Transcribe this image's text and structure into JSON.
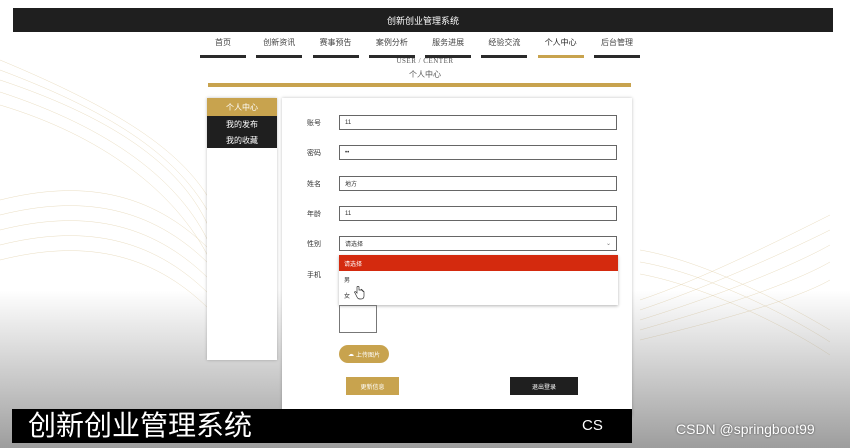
{
  "app": {
    "title": "创新创业管理系统"
  },
  "nav": {
    "items": [
      {
        "label": "首页"
      },
      {
        "label": "创新资讯"
      },
      {
        "label": "赛事预告"
      },
      {
        "label": "案例分析"
      },
      {
        "label": "服务进展"
      },
      {
        "label": "经验交流"
      },
      {
        "label": "个人中心"
      },
      {
        "label": "后台管理"
      }
    ],
    "active": "个人中心"
  },
  "section": {
    "title_en": "USER / CENTER",
    "title_cn": "个人中心"
  },
  "sidebar": {
    "items": [
      {
        "label": "个人中心"
      },
      {
        "label": "我的发布"
      },
      {
        "label": "我的收藏"
      }
    ]
  },
  "form": {
    "account": {
      "label": "账号",
      "value": "11"
    },
    "password": {
      "label": "密码",
      "value": "••"
    },
    "name": {
      "label": "姓名",
      "value": "地方"
    },
    "age": {
      "label": "年龄",
      "value": "11"
    },
    "gender": {
      "label": "性别",
      "value": "请选择",
      "options": [
        {
          "label": "请选择"
        },
        {
          "label": "男"
        },
        {
          "label": "女"
        }
      ]
    },
    "phone": {
      "label": "手机"
    },
    "upload_label": "上传图片",
    "update_label": "更新信息",
    "logout_label": "退出登录"
  },
  "caption": {
    "title": "创新创业管理系统",
    "logo_text": "CS"
  },
  "watermark": "CSDN @springboot99",
  "colors": {
    "accent": "#c8a34e",
    "dark": "#1f1f1f",
    "selected_option": "#d42a0e"
  }
}
